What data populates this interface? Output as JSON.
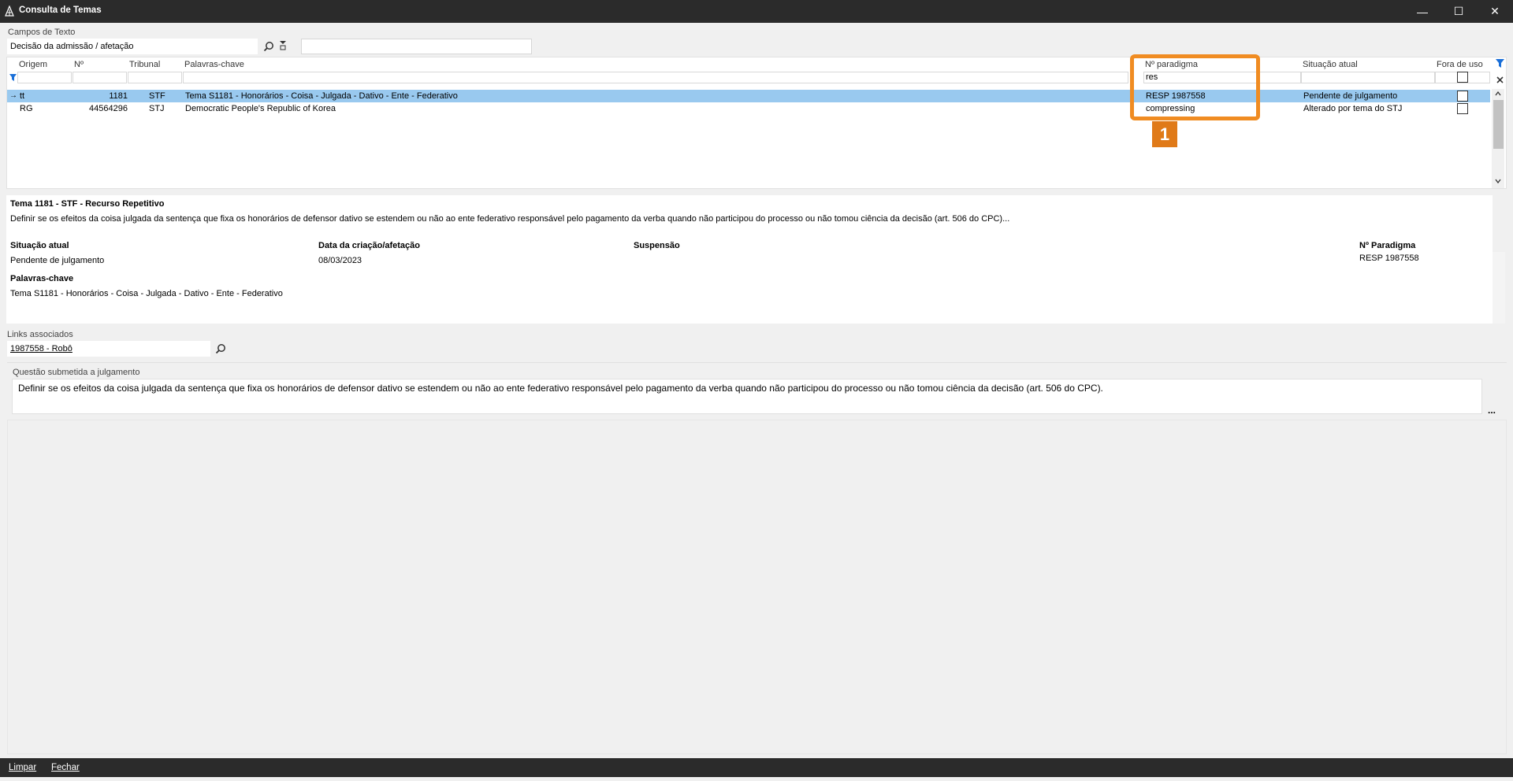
{
  "window": {
    "title": "Consulta de Temas",
    "minimize": "—",
    "maximize": "☐",
    "close": "✕"
  },
  "text_fields": {
    "label": "Campos de Texto",
    "field_value": "Decisão da admissão / afetação",
    "search_value": ""
  },
  "grid": {
    "columns": [
      "Origem",
      "Nº",
      "Tribunal",
      "Palavras-chave",
      "Nº paradigma",
      "Situação atual",
      "Fora de uso"
    ],
    "filters": {
      "paradigma": "res"
    },
    "rows": [
      {
        "origem": "tt",
        "numero": "1181",
        "tribunal": "STF",
        "palavras": "Tema S1181 - Honorários - Coisa - Julgada - Dativo - Ente - Federativo",
        "paradigma": "RESP 1987558",
        "situacao": "Pendente de julgamento"
      },
      {
        "origem": "RG",
        "numero": "44564296",
        "tribunal": "STJ",
        "palavras": "Democratic People's Republic of Korea",
        "paradigma": "compressing",
        "situacao": "Alterado por tema do STJ"
      }
    ]
  },
  "highlight": {
    "number": "1",
    "color": "#f08c22"
  },
  "details": {
    "title": "Tema 1181 - STF - Recurso Repetitivo",
    "summary": "Definir se os efeitos da coisa julgada da sentença que fixa os honorários de defensor dativo se estendem ou não ao ente federativo responsável pelo pagamento da verba quando não participou do processo ou não tomou ciência da decisão (art. 506 do CPC)...",
    "situacao_label": "Situação atual",
    "situacao_value": "Pendente de julgamento",
    "data_label": "Data da criação/afetação",
    "data_value": "08/03/2023",
    "suspensao_label": "Suspensão",
    "paradigma_label": "Nº Paradigma",
    "paradigma_value": "RESP 1987558",
    "palavras_label": "Palavras-chave",
    "palavras_value": "Tema S1181 - Honorários - Coisa - Julgada - Dativo - Ente - Federativo"
  },
  "links": {
    "label": "Links associados",
    "value": "1987558 - Robô"
  },
  "questao": {
    "label": "Questão submetida a julgamento",
    "text": "Definir se os efeitos da coisa julgada da sentença que fixa os honorários de defensor dativo se estendem ou não ao ente federativo responsável pelo pagamento da verba quando não participou do processo ou não tomou ciência da decisão (art. 506 do CPC).",
    "more": "..."
  },
  "footer": {
    "limpar": "Limpar",
    "fechar": "Fechar"
  }
}
